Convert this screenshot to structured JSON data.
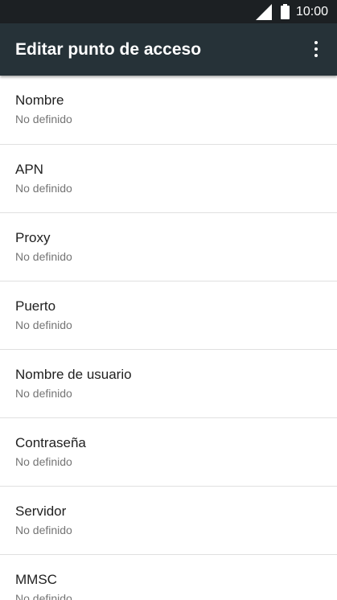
{
  "status_bar": {
    "time": "10:00",
    "icons": [
      "cell-signal-icon",
      "battery-icon"
    ]
  },
  "app_bar": {
    "title": "Editar punto de acceso",
    "overflow_icon": "more-vert-icon"
  },
  "settings": [
    {
      "key": "nombre",
      "label": "Nombre",
      "value": "No definido"
    },
    {
      "key": "apn",
      "label": "APN",
      "value": "No definido"
    },
    {
      "key": "proxy",
      "label": "Proxy",
      "value": "No definido"
    },
    {
      "key": "puerto",
      "label": "Puerto",
      "value": "No definido"
    },
    {
      "key": "nombre-de-usuario",
      "label": "Nombre de usuario",
      "value": "No definido"
    },
    {
      "key": "contrasena",
      "label": "Contraseña",
      "value": "No definido"
    },
    {
      "key": "servidor",
      "label": "Servidor",
      "value": "No definido"
    },
    {
      "key": "mmsc",
      "label": "MMSC",
      "value": "No definido"
    }
  ]
}
